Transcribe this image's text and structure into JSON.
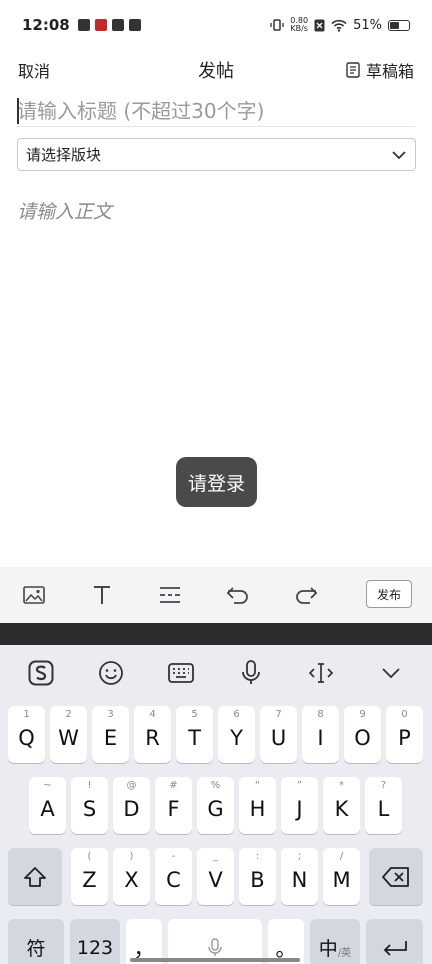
{
  "status": {
    "time": "12:08",
    "netspeed_value": "0.80",
    "netspeed_unit": "KB/s",
    "battery": "51%",
    "battery_level": 0.51
  },
  "header": {
    "cancel": "取消",
    "title": "发帖",
    "drafts": "草稿箱"
  },
  "form": {
    "title_placeholder": "请输入标题 (不超过30个字)",
    "section_placeholder": "请选择版块",
    "body_placeholder": "请输入正文"
  },
  "toast": "请登录",
  "toolbar": {
    "publish": "发布",
    "icons": [
      "image-icon",
      "text-format-icon",
      "divider-icon",
      "undo-icon",
      "redo-icon"
    ]
  },
  "keyboard": {
    "row1": [
      {
        "key": "Q",
        "hint": "1"
      },
      {
        "key": "W",
        "hint": "2"
      },
      {
        "key": "E",
        "hint": "3"
      },
      {
        "key": "R",
        "hint": "4"
      },
      {
        "key": "T",
        "hint": "5"
      },
      {
        "key": "Y",
        "hint": "6"
      },
      {
        "key": "U",
        "hint": "7"
      },
      {
        "key": "I",
        "hint": "8"
      },
      {
        "key": "O",
        "hint": "9"
      },
      {
        "key": "P",
        "hint": "0"
      }
    ],
    "row2": [
      {
        "key": "A",
        "hint": "~"
      },
      {
        "key": "S",
        "hint": "!"
      },
      {
        "key": "D",
        "hint": "@"
      },
      {
        "key": "F",
        "hint": "#"
      },
      {
        "key": "G",
        "hint": "%"
      },
      {
        "key": "H",
        "hint": "“"
      },
      {
        "key": "J",
        "hint": "”"
      },
      {
        "key": "K",
        "hint": "*"
      },
      {
        "key": "L",
        "hint": "?"
      }
    ],
    "row3": [
      {
        "key": "Z",
        "hint": "("
      },
      {
        "key": "X",
        "hint": ")"
      },
      {
        "key": "C",
        "hint": "-"
      },
      {
        "key": "V",
        "hint": "_"
      },
      {
        "key": "B",
        "hint": ":"
      },
      {
        "key": "N",
        "hint": ";"
      },
      {
        "key": "M",
        "hint": "/"
      }
    ],
    "symbols_key": "符",
    "numbers_key": "123",
    "comma_key": "，",
    "period_key": "。",
    "lang_key_main": "中",
    "lang_key_sub": "/英"
  }
}
